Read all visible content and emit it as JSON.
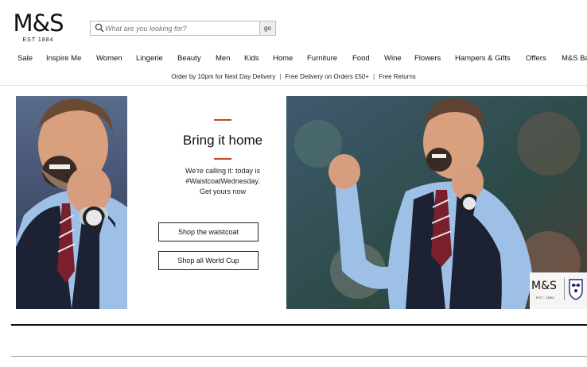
{
  "brand": {
    "logo": "M&S",
    "est": "EST 1884"
  },
  "search": {
    "placeholder": "What are you looking for?",
    "button": "go",
    "icon": "search-icon"
  },
  "nav": [
    "Sale",
    "Inspire Me",
    "Women",
    "Lingerie",
    "Beauty",
    "Men",
    "Kids",
    "Home",
    "Furniture",
    "Food",
    "Wine",
    "Flowers",
    "Hampers & Gifts",
    "Offers",
    "M&S Ba"
  ],
  "promo": [
    "Order by 10pm for Next Day Delivery",
    "Free Delivery on Orders £50+",
    "Free Returns"
  ],
  "hero": {
    "headline": "Bring it home",
    "body_lines": [
      "We're calling it: today is",
      "#WaistcoatWednesday.",
      "Get yours now"
    ],
    "cta_primary": "Shop the waistcoat",
    "cta_secondary": "Shop all World Cup",
    "badge_logo": "M&S",
    "badge_est": "EST. 1884"
  },
  "colors": {
    "accent": "#c8452c",
    "text": "#111111",
    "shirt": "#9fc0e6",
    "waistcoat": "#1c2233"
  }
}
